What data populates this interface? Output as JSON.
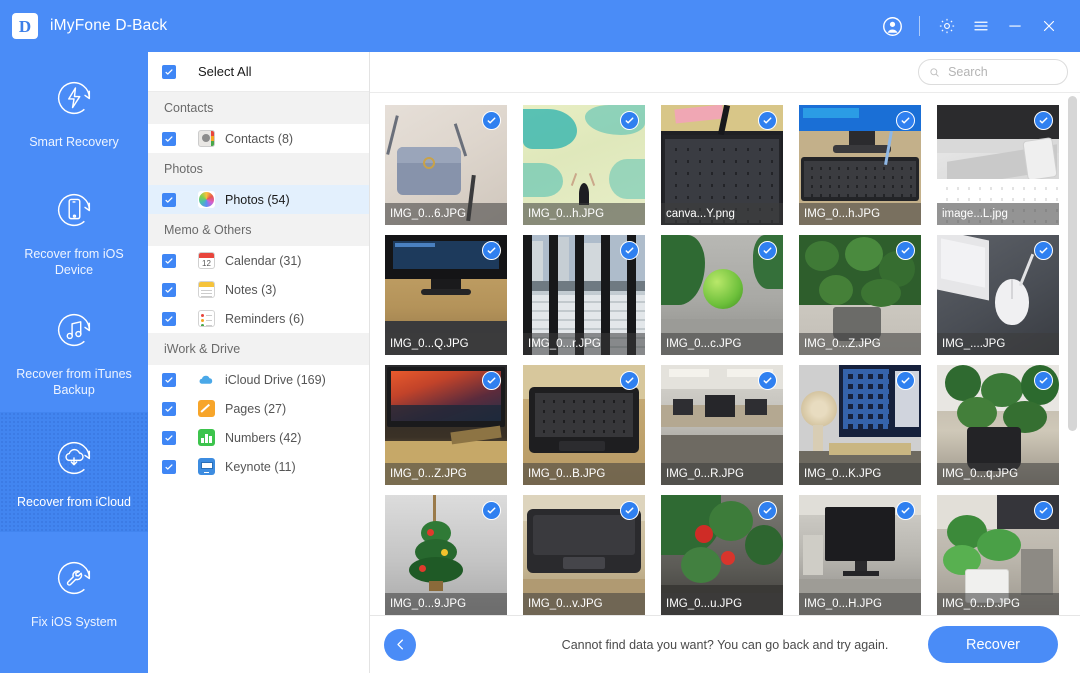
{
  "titlebar": {
    "app_title": "iMyFone D-Back",
    "logo_letter": "D",
    "icons": [
      {
        "name": "account-icon",
        "glyph": "●"
      },
      {
        "name": "settings-gear-icon",
        "glyph": "⚙"
      },
      {
        "name": "menu-hamburger-icon",
        "glyph": "≡"
      },
      {
        "name": "minimize-icon",
        "glyph": "−"
      },
      {
        "name": "close-icon",
        "glyph": "✕"
      }
    ],
    "accent_color": "#4a8cf7"
  },
  "sidebar": {
    "items": [
      {
        "label": "Smart Recovery",
        "icon": "bolt-refresh-icon",
        "active": false
      },
      {
        "label": "Recover from iOS Device",
        "icon": "phone-refresh-icon",
        "active": false
      },
      {
        "label": "Recover from iTunes Backup",
        "icon": "music-refresh-icon",
        "active": false
      },
      {
        "label": "Recover from iCloud",
        "icon": "cloud-download-refresh-icon",
        "active": true
      },
      {
        "label": "Fix iOS System",
        "icon": "wrench-refresh-icon",
        "active": false
      }
    ]
  },
  "tree": {
    "select_all_label": "Select All",
    "select_all_checked": true,
    "groups": [
      {
        "title": "Contacts",
        "rows": [
          {
            "label": "Contacts (8)",
            "checked": true,
            "selected": false,
            "icon": "contacts-app-icon"
          }
        ]
      },
      {
        "title": "Photos",
        "rows": [
          {
            "label": "Photos (54)",
            "checked": true,
            "selected": true,
            "icon": "photos-app-icon"
          }
        ]
      },
      {
        "title": "Memo & Others",
        "rows": [
          {
            "label": "Calendar (31)",
            "checked": true,
            "selected": false,
            "icon": "calendar-app-icon"
          },
          {
            "label": "Notes (3)",
            "checked": true,
            "selected": false,
            "icon": "notes-app-icon"
          },
          {
            "label": "Reminders (6)",
            "checked": true,
            "selected": false,
            "icon": "reminders-app-icon"
          }
        ]
      },
      {
        "title": "iWork & Drive",
        "rows": [
          {
            "label": "iCloud Drive (169)",
            "checked": true,
            "selected": false,
            "icon": "icloud-drive-app-icon"
          },
          {
            "label": "Pages (27)",
            "checked": true,
            "selected": false,
            "icon": "pages-app-icon"
          },
          {
            "label": "Numbers (42)",
            "checked": true,
            "selected": false,
            "icon": "numbers-app-icon"
          },
          {
            "label": "Keynote (11)",
            "checked": true,
            "selected": false,
            "icon": "keynote-app-icon"
          }
        ]
      }
    ]
  },
  "search": {
    "placeholder": "Search",
    "value": ""
  },
  "gallery": {
    "items": [
      {
        "caption": "IMG_0...6.JPG",
        "checked": true,
        "active": false,
        "scene": "handbag-on-floor"
      },
      {
        "caption": "IMG_0...h.JPG",
        "checked": true,
        "active": false,
        "scene": "person-on-painted-wall"
      },
      {
        "caption": "canva...Y.png",
        "checked": true,
        "active": false,
        "scene": "black-keyboard-desk"
      },
      {
        "caption": "IMG_0...h.JPG",
        "checked": true,
        "active": false,
        "scene": "monitor-and-keyboard"
      },
      {
        "caption": "image...L.jpg",
        "checked": true,
        "active": false,
        "scene": "imac-white-keyboard"
      },
      {
        "caption": "IMG_0...Q.JPG",
        "checked": true,
        "active": false,
        "scene": "samsung-monitor-desk"
      },
      {
        "caption": "IMG_0...r.JPG",
        "checked": true,
        "active": true,
        "scene": "city-view-through-blinds"
      },
      {
        "caption": "IMG_0...c.JPG",
        "checked": true,
        "active": false,
        "scene": "green-ball-on-desk"
      },
      {
        "caption": "IMG_0...Z.JPG",
        "checked": true,
        "active": false,
        "scene": "potted-plant-window"
      },
      {
        "caption": "IMG_....JPG",
        "checked": true,
        "active": false,
        "scene": "laptop-and-mouse"
      },
      {
        "caption": "IMG_0...Z.JPG",
        "checked": true,
        "active": false,
        "scene": "monitor-night-scene"
      },
      {
        "caption": "IMG_0...B.JPG",
        "checked": true,
        "active": false,
        "scene": "laptop-keyboard-closeup"
      },
      {
        "caption": "IMG_0...R.JPG",
        "checked": true,
        "active": false,
        "scene": "office-room-interior"
      },
      {
        "caption": "IMG_0...K.JPG",
        "checked": true,
        "active": false,
        "scene": "desk-fan-and-monitor"
      },
      {
        "caption": "IMG_0...q.JPG",
        "checked": true,
        "active": false,
        "scene": "plant-in-black-pot"
      },
      {
        "caption": "IMG_0...9.JPG",
        "checked": true,
        "active": false,
        "scene": "christmas-ornament"
      },
      {
        "caption": "IMG_0...v.JPG",
        "checked": true,
        "active": false,
        "scene": "macbook-on-desk"
      },
      {
        "caption": "IMG_0...u.JPG",
        "checked": true,
        "active": false,
        "scene": "red-flower-plant"
      },
      {
        "caption": "IMG_0...H.JPG",
        "checked": true,
        "active": false,
        "scene": "office-desk-monitor"
      },
      {
        "caption": "IMG_0...D.JPG",
        "checked": true,
        "active": false,
        "scene": "green-plant-desk"
      }
    ]
  },
  "footer": {
    "message": "Cannot find data you want? You can go back and try again.",
    "back_icon": "back-arrow-icon",
    "recover_label": "Recover"
  }
}
